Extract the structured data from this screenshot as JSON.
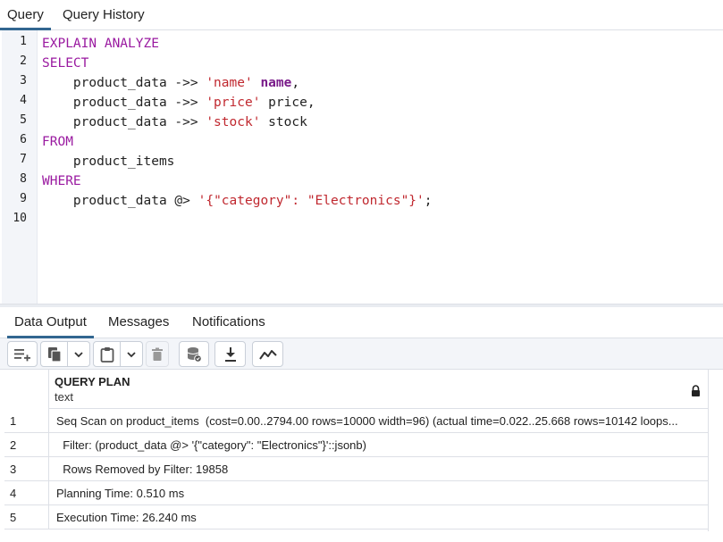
{
  "top_tabs": {
    "query": "Query",
    "history": "Query History"
  },
  "editor": {
    "line_numbers": [
      "1",
      "2",
      "3",
      "4",
      "5",
      "6",
      "7",
      "8",
      "9",
      "10"
    ],
    "lines": {
      "l1_kw": "EXPLAIN ANALYZE",
      "l2_kw": "SELECT",
      "l3_pre": "    product_data ->> ",
      "l3_str": "'name'",
      "l3_alias": "name",
      "l3_post": ",",
      "l4_pre": "    product_data ->> ",
      "l4_str": "'price'",
      "l4_post": " price,",
      "l5_pre": "    product_data ->> ",
      "l5_str": "'stock'",
      "l5_post": " stock",
      "l6_kw": "FROM",
      "l7": "    product_items",
      "l8_kw": "WHERE",
      "l9_pre": "    product_data @> ",
      "l9_str": "'{\"category\": \"Electronics\"}'",
      "l9_post": ";"
    }
  },
  "bottom_tabs": {
    "data_output": "Data Output",
    "messages": "Messages",
    "notifications": "Notifications"
  },
  "toolbar": {
    "icons": [
      "add-row-icon",
      "copy-icon",
      "chevron-down-icon",
      "paste-icon",
      "chevron-down-icon",
      "delete-icon",
      "save-data-icon",
      "download-icon",
      "graph-icon"
    ]
  },
  "grid": {
    "column": {
      "name": "QUERY PLAN",
      "type": "text"
    },
    "rows": [
      {
        "num": "1",
        "value": "Seq Scan on product_items  (cost=0.00..2794.00 rows=10000 width=96) (actual time=0.022..25.668 rows=10142 loops..."
      },
      {
        "num": "2",
        "value": "  Filter: (product_data @> '{\"category\": \"Electronics\"}'::jsonb)"
      },
      {
        "num": "3",
        "value": "  Rows Removed by Filter: 19858"
      },
      {
        "num": "4",
        "value": "Planning Time: 0.510 ms"
      },
      {
        "num": "5",
        "value": "Execution Time: 26.240 ms"
      }
    ]
  },
  "colors": {
    "accent": "#326690",
    "keyword": "#9a1aa0",
    "string": "#c0282f"
  }
}
